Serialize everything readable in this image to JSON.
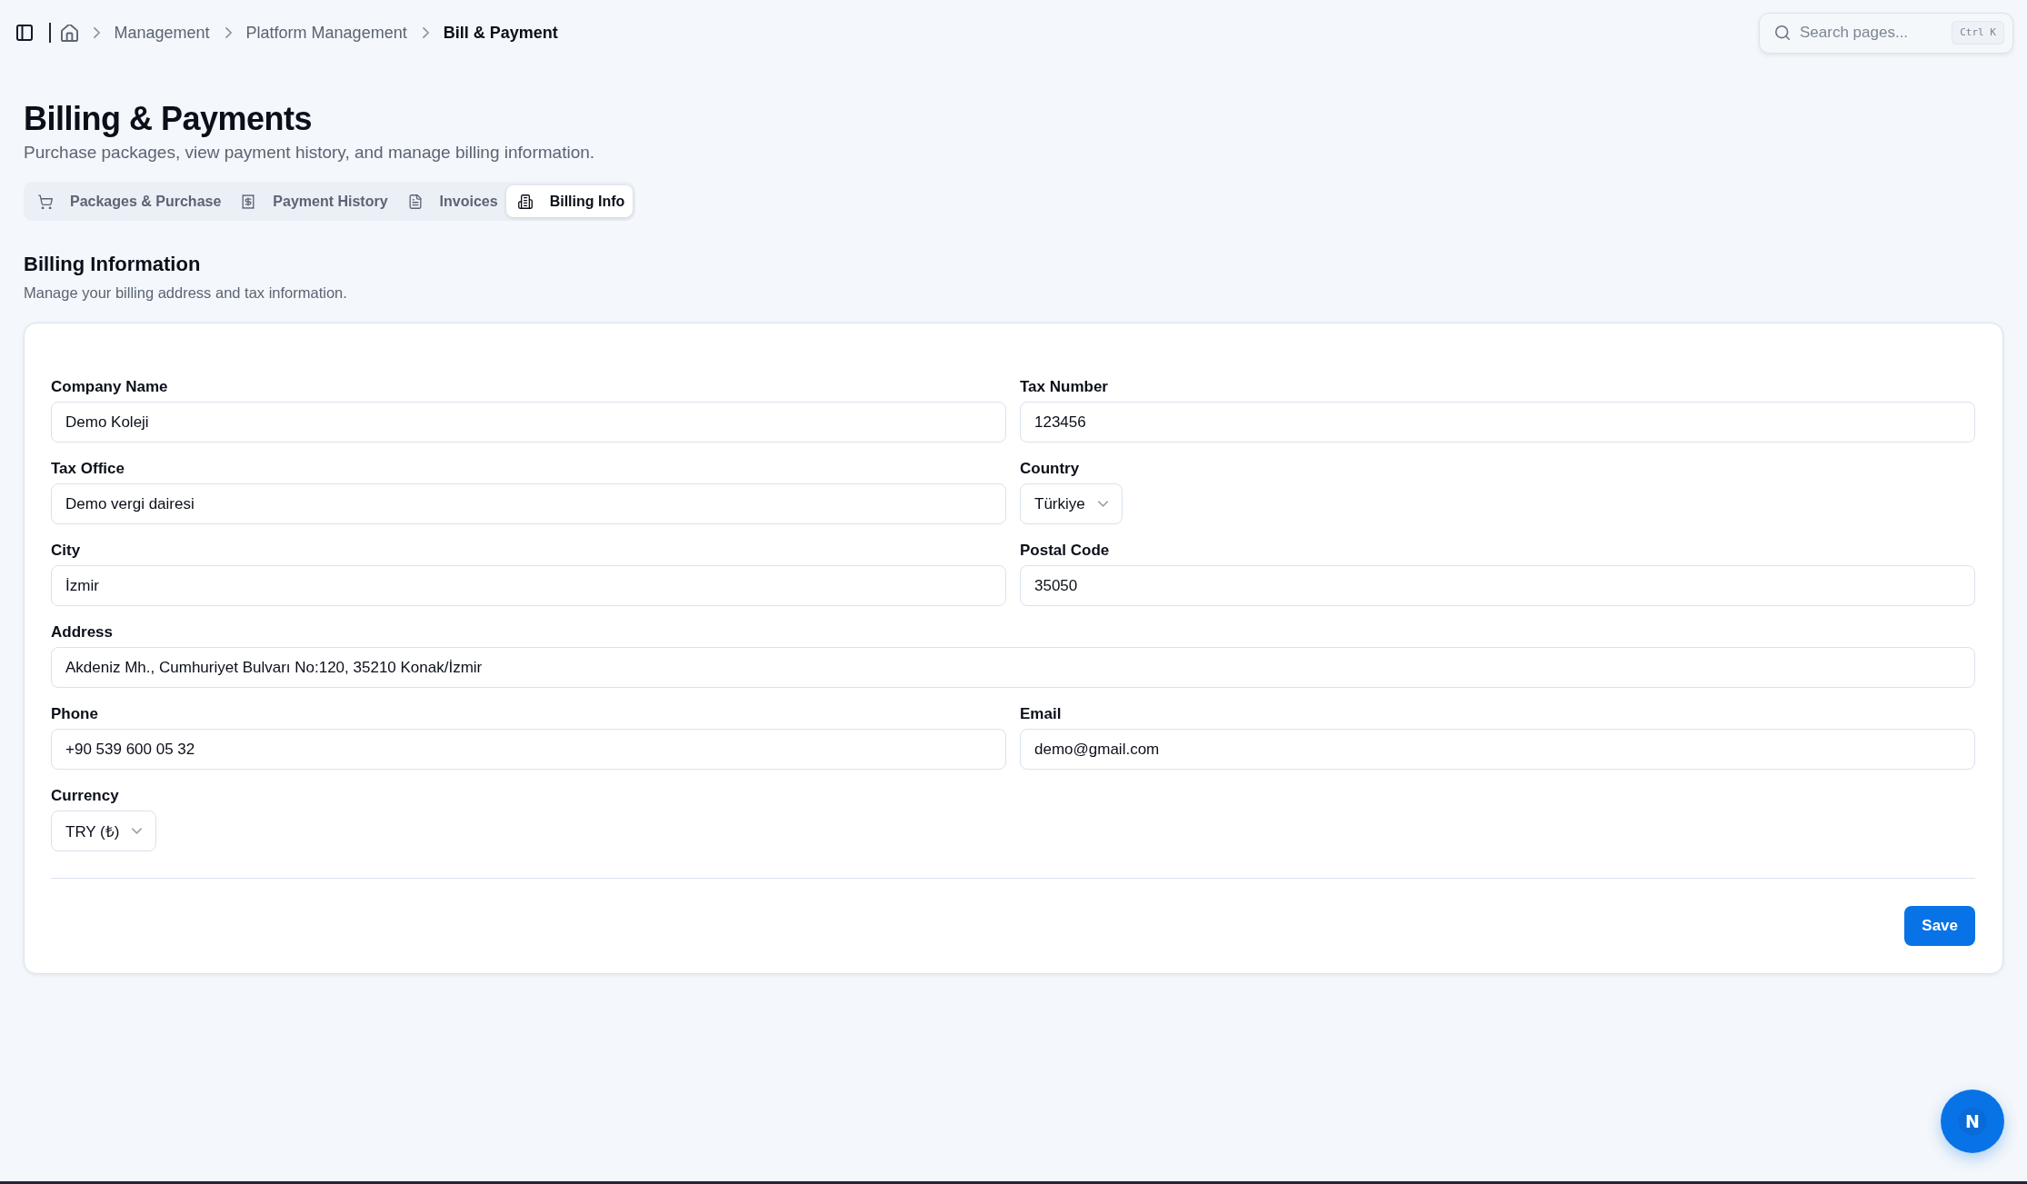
{
  "topbar": {
    "breadcrumbs": [
      {
        "label": "Management",
        "current": false
      },
      {
        "label": "Platform Management",
        "current": false
      },
      {
        "label": "Bill & Payment",
        "current": true
      }
    ],
    "search": {
      "placeholder": "Search pages...",
      "shortcut": "Ctrl K"
    }
  },
  "page": {
    "title": "Billing & Payments",
    "subtitle": "Purchase packages, view payment history, and manage billing information."
  },
  "tabs": [
    {
      "label": "Packages & Purchase",
      "selected": false
    },
    {
      "label": "Payment History",
      "selected": false
    },
    {
      "label": "Invoices",
      "selected": false
    },
    {
      "label": "Billing Info",
      "selected": true
    }
  ],
  "section": {
    "title": "Billing Information",
    "subtitle": "Manage your billing address and tax information."
  },
  "form": {
    "fields": [
      {
        "label": "Company Name",
        "kind": "text",
        "value": "Demo Koleji"
      },
      {
        "label": "Tax Number",
        "kind": "text",
        "value": "123456"
      },
      {
        "label": "Tax Office",
        "kind": "text",
        "value": "Demo vergi dairesi"
      },
      {
        "label": "Country",
        "kind": "select",
        "value": "Türkiye"
      },
      {
        "label": "City",
        "kind": "text",
        "value": "İzmir"
      },
      {
        "label": "Postal Code",
        "kind": "text",
        "value": "35050"
      },
      {
        "label": "Address",
        "kind": "wide",
        "value": "Akdeniz Mh., Cumhuriyet Bulvarı No:120, 35210 Konak/İzmir"
      },
      {
        "label": "Phone",
        "kind": "text",
        "value": "+90 539 600 05 32"
      },
      {
        "label": "Email",
        "kind": "text",
        "value": "demo@gmail.com"
      },
      {
        "label": "Currency",
        "kind": "select",
        "value": "TRY (₺)"
      }
    ],
    "save_button": "Save"
  },
  "fab": {
    "label": "N"
  }
}
